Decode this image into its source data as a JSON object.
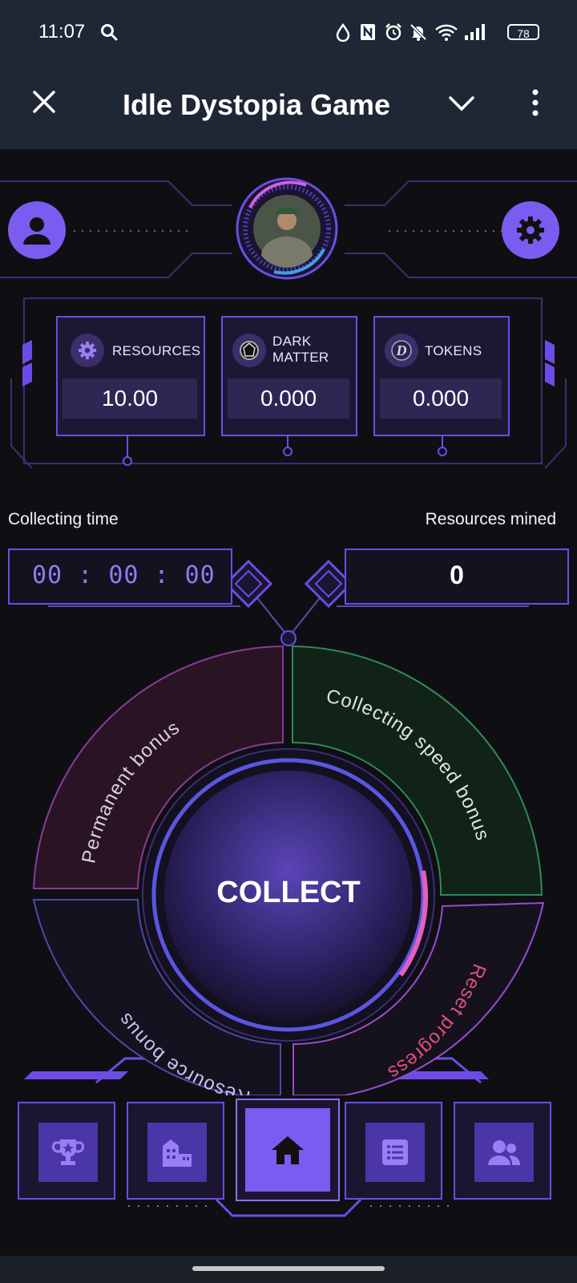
{
  "status_bar": {
    "time": "11:07",
    "battery": "78",
    "icons": [
      "search-icon",
      "water-drop-icon",
      "nfc-icon",
      "alarm-icon",
      "bell-off-icon",
      "wifi-icon",
      "signal-icon",
      "battery-icon"
    ]
  },
  "app_bar": {
    "title": "Idle Dystopia Game",
    "icons": [
      "close-icon",
      "chevron-down-icon",
      "more-vert-icon"
    ]
  },
  "currencies": [
    {
      "label": "RESOURCES",
      "value": "10.00",
      "icon": "gear-icon"
    },
    {
      "label": "DARK MATTER",
      "label_line1": "DARK",
      "label_line2": "MATTER",
      "value": "0.000",
      "icon": "dark-matter-icon"
    },
    {
      "label": "TOKENS",
      "value": "0.000",
      "icon": "token-d-icon"
    }
  ],
  "collecting": {
    "time_label": "Collecting time",
    "hours": "00",
    "minutes": "00",
    "seconds": "00",
    "mined_label": "Resources mined",
    "mined_value": "0"
  },
  "wheel": {
    "collect_label": "COLLECT",
    "permanent_bonus": "Permanent bonus",
    "collecting_speed_bonus": "Collecting speed bonus",
    "resource_bonus": "Resource bonus",
    "reset_progress": "Reset progress"
  },
  "colors": {
    "accent": "#6b4de6",
    "status_bg": "#1e2733",
    "game_bg": "#0f0f13",
    "reset_text": "#e0507a",
    "speed_border": "#2f8a55",
    "permanent_border": "#8a3a9a"
  },
  "bottom_nav": [
    {
      "name": "achievements",
      "icon": "trophy-icon"
    },
    {
      "name": "city",
      "icon": "city-icon"
    },
    {
      "name": "home",
      "icon": "home-icon",
      "active": true
    },
    {
      "name": "tasks",
      "icon": "list-icon"
    },
    {
      "name": "friends",
      "icon": "users-icon"
    }
  ]
}
